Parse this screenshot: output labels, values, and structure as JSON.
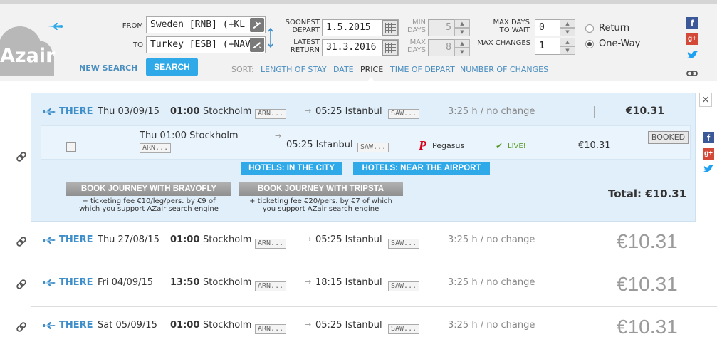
{
  "header": {
    "logo": "Azair",
    "from_label": "FROM",
    "to_label": "TO",
    "from_value": "Sweden [RNB] (+KL",
    "to_value": "Turkey [ESB] (+NAV",
    "soonest_depart_label": [
      "SOONEST",
      "DEPART"
    ],
    "latest_return_label": [
      "LATEST",
      "RETURN"
    ],
    "soonest_depart_value": "1.5.2015",
    "latest_return_value": "31.3.2016",
    "min_days_label": [
      "MIN",
      "DAYS"
    ],
    "max_days_label": [
      "MAX",
      "DAYS"
    ],
    "min_days_value": "5",
    "max_days_value": "8",
    "max_days_wait_label": [
      "MAX DAYS",
      "TO WAIT"
    ],
    "max_changes_label": "MAX CHANGES",
    "max_days_wait_value": "0",
    "max_changes_value": "1",
    "return_label": "Return",
    "oneway_label": "One-Way",
    "new_search": "NEW SEARCH",
    "search": "SEARCH",
    "sort_label": "SORT:",
    "sort_options": [
      "LENGTH OF STAY",
      "DATE",
      "PRICE",
      "TIME OF DEPART",
      "NUMBER OF CHANGES"
    ],
    "social": {
      "fb": "f",
      "gp": "g+",
      "tw": "t"
    }
  },
  "expanded": {
    "direction": "THERE",
    "date": "Thu 03/09/15",
    "dep_time": "01:00",
    "dep_city": "Stockholm",
    "dep_code": "ARN...",
    "arr_time": "05:25",
    "arr_city": "Istanbul",
    "arr_code": "SAW...",
    "duration": "3:25 h / no change",
    "price": "€10.31",
    "leg": {
      "dep": "Thu 01:00 Stockholm",
      "dep_code": "ARN...",
      "arr": "05:25 Istanbul",
      "arr_code": "SAW...",
      "airline": "Pegasus",
      "live": "LIVE!",
      "price": "€10.31",
      "booked": "BOOKED"
    },
    "hotels_city": "HOTELS: IN THE CITY",
    "hotels_airport": "HOTELS: NEAR THE AIRPORT",
    "book1": "BOOK JOURNEY WITH BRAVOFLY",
    "book1_fee": [
      "+ ticketing fee €10/leg/pers. by €9 of",
      "which you support AZair search engine"
    ],
    "book2": "BOOK JOURNEY WITH TRIPSTA",
    "book2_fee": [
      "+ ticketing fee €20/pers. by €7 of which",
      "you support AZair search engine"
    ],
    "total": "Total: €10.31",
    "close": "×"
  },
  "rows": [
    {
      "direction": "THERE",
      "date": "Thu 27/08/15",
      "dep_time": "01:00",
      "dep_city": "Stockholm",
      "dep_code": "ARN...",
      "arr_time": "05:25",
      "arr_city": "Istanbul",
      "arr_code": "SAW...",
      "duration": "3:25 h / no change",
      "price": "€10.31"
    },
    {
      "direction": "THERE",
      "date": "Fri 04/09/15",
      "dep_time": "13:50",
      "dep_city": "Stockholm",
      "dep_code": "ARN...",
      "arr_time": "18:15",
      "arr_city": "Istanbul",
      "arr_code": "SAW...",
      "duration": "3:25 h / no change",
      "price": "€10.31"
    },
    {
      "direction": "THERE",
      "date": "Sat 05/09/15",
      "dep_time": "01:00",
      "dep_city": "Stockholm",
      "dep_code": "ARN...",
      "arr_time": "05:25",
      "arr_city": "Istanbul",
      "arr_code": "SAW...",
      "duration": "3:25 h / no change",
      "price": "€10.31"
    }
  ],
  "colors": {
    "accent": "#30a9e8",
    "link": "#4a8ec0",
    "expanded_bg": "#e1effa"
  }
}
